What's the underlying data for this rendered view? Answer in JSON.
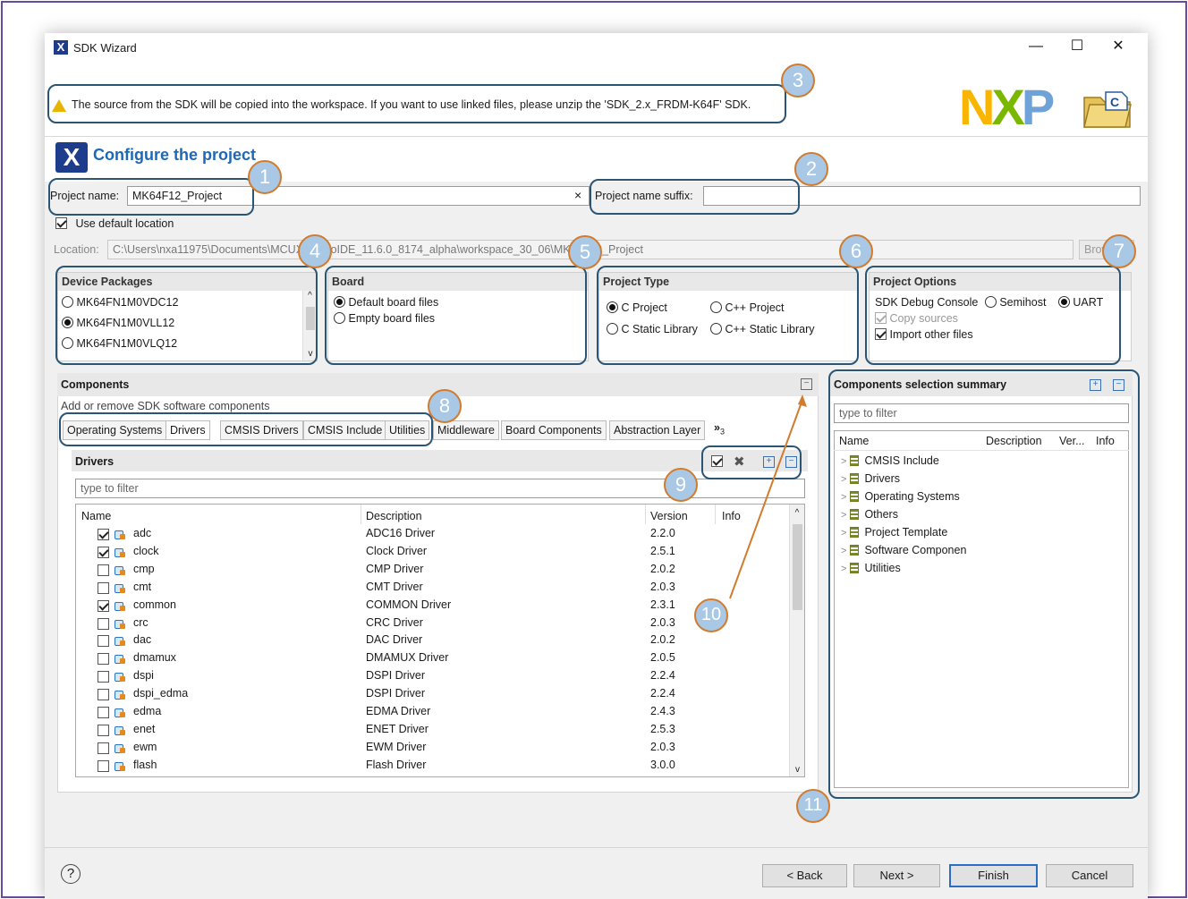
{
  "window": {
    "title": "SDK Wizard",
    "minimize": "—",
    "maximize": "☐",
    "close": "✕"
  },
  "banner": {
    "warning": "The source from the SDK will be copied into the workspace. If you want to use linked files, please unzip the 'SDK_2.x_FRDM-K64F' SDK.",
    "logo_text": "NXP"
  },
  "header": {
    "title": "Configure the project"
  },
  "project": {
    "name_label": "Project name:",
    "name_value": "MK64F12_Project",
    "clear_icon": "×",
    "suffix_label": "Project name suffix:",
    "suffix_value": "",
    "use_default_label": "Use default location",
    "location_label": "Location:",
    "location_value": "C:\\Users\\nxa11975\\Documents\\MCUXpressoIDE_11.6.0_8174_alpha\\workspace_30_06\\MK64F12_Project",
    "browse_label": "Browse..."
  },
  "device_packages": {
    "title": "Device Packages",
    "items": [
      "MK64FN1M0VDC12",
      "MK64FN1M0VLL12",
      "MK64FN1M0VLQ12"
    ],
    "selected_index": 1
  },
  "board": {
    "title": "Board",
    "items": [
      "Default board files",
      "Empty board files"
    ]
  },
  "project_type": {
    "title": "Project Type",
    "c_project": "C Project",
    "cpp_project": "C++ Project",
    "c_static": "C Static Library",
    "cpp_static": "C++ Static Library"
  },
  "project_options": {
    "title": "Project Options",
    "debug_console": "SDK Debug Console",
    "semihost": "Semihost",
    "uart": "UART",
    "copy_sources": "Copy sources",
    "import_other": "Import other files"
  },
  "components": {
    "title": "Components",
    "subtitle": "Add or remove SDK software components",
    "tabs": [
      "Operating Systems",
      "Drivers",
      "CMSIS Drivers",
      "CMSIS Include",
      "Utilities",
      "Middleware",
      "Board Components",
      "Abstraction Layer"
    ],
    "more_tabs": "»",
    "more_count": "3",
    "drivers_title": "Drivers",
    "filter_placeholder": "type to filter",
    "columns": [
      "Name",
      "Description",
      "Version",
      "Info"
    ],
    "rows": [
      {
        "name": "adc",
        "description": "ADC16 Driver",
        "version": "2.2.0",
        "checked": true
      },
      {
        "name": "clock",
        "description": "Clock Driver",
        "version": "2.5.1",
        "checked": true
      },
      {
        "name": "cmp",
        "description": "CMP Driver",
        "version": "2.0.2",
        "checked": false
      },
      {
        "name": "cmt",
        "description": "CMT Driver",
        "version": "2.0.3",
        "checked": false
      },
      {
        "name": "common",
        "description": "COMMON Driver",
        "version": "2.3.1",
        "checked": true
      },
      {
        "name": "crc",
        "description": "CRC Driver",
        "version": "2.0.3",
        "checked": false
      },
      {
        "name": "dac",
        "description": "DAC Driver",
        "version": "2.0.2",
        "checked": false
      },
      {
        "name": "dmamux",
        "description": "DMAMUX Driver",
        "version": "2.0.5",
        "checked": false
      },
      {
        "name": "dspi",
        "description": "DSPI Driver",
        "version": "2.2.4",
        "checked": false
      },
      {
        "name": "dspi_edma",
        "description": "DSPI Driver",
        "version": "2.2.4",
        "checked": false
      },
      {
        "name": "edma",
        "description": "EDMA Driver",
        "version": "2.4.3",
        "checked": false
      },
      {
        "name": "enet",
        "description": "ENET Driver",
        "version": "2.5.3",
        "checked": false
      },
      {
        "name": "ewm",
        "description": "EWM Driver",
        "version": "2.0.3",
        "checked": false
      },
      {
        "name": "flash",
        "description": "Flash Driver",
        "version": "3.0.0",
        "checked": false
      }
    ]
  },
  "summary": {
    "title": "Components selection summary",
    "filter_placeholder": "type to filter",
    "columns": [
      "Name",
      "Description",
      "Ver...",
      "Info"
    ],
    "items": [
      "CMSIS Include",
      "Drivers",
      "Operating Systems",
      "Others",
      "Project Template",
      "Software Componen",
      "Utilities"
    ]
  },
  "callouts": [
    "1",
    "2",
    "3",
    "4",
    "5",
    "6",
    "7",
    "8",
    "9",
    "10",
    "11"
  ],
  "footer": {
    "help": "?",
    "back": "< Back",
    "next": "Next >",
    "finish": "Finish",
    "cancel": "Cancel"
  },
  "colors": {
    "accent": "#1d68b8",
    "callout_border": "#2b5575",
    "badge_fill": "#a8c8e6",
    "badge_ring": "#d27b2d",
    "nxp_n": "#f9b500",
    "nxp_x": "#7ab800",
    "nxp_p": "#6fa3d7"
  }
}
